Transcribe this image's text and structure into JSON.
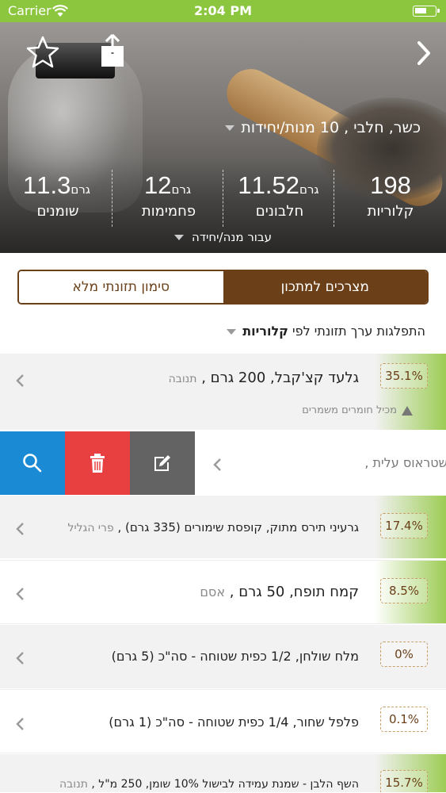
{
  "status_bar": {
    "carrier": "Carrier",
    "time": "2:04 PM"
  },
  "hero": {
    "kosher_info": "כשר, חלבי , 10 מנות/יחידות",
    "stats": [
      {
        "value": "198",
        "unit": "",
        "label": "קלוריות"
      },
      {
        "value": "11.52",
        "unit": "גרם",
        "label": "חלבונים"
      },
      {
        "value": "12",
        "unit": "גרם",
        "label": "פחמימות"
      },
      {
        "value": "11.3",
        "unit": "גרם",
        "label": "שומנים"
      }
    ],
    "serving_note": "עבור מנה/יחידה"
  },
  "tabs": {
    "active": "מצרכים למתכון",
    "inactive": "סימון תזונתי מלא"
  },
  "distribution": {
    "prefix": "התפלגות ערך תזונתי לפי",
    "metric": "קלוריות"
  },
  "ingredients": [
    {
      "percent": "35.1%",
      "name": "גלעד קצ'קבל, 200 גרם",
      "brand": "תנובה",
      "warning": "מכיל חומרים משמרים"
    },
    {
      "name": "שטראוס עלית"
    },
    {
      "percent": "17.4%",
      "name": "גרעיני תירס מתוק, קופסת שימורים (335 גרם)",
      "brand": "פרי הגליל"
    },
    {
      "percent": "8.5%",
      "name": "קמח תופח, 50 גרם",
      "brand": "אסם"
    },
    {
      "percent": "0%",
      "name": "מלח שולחן, 1/2 כפית שטוחה - סה\"כ (5 גרם)"
    },
    {
      "percent": "0.1%",
      "name": "פלפל שחור, 1/4 כפית שטוחה - סה\"כ (1 גרם)"
    },
    {
      "percent": "15.7%",
      "name": "השף הלבן - שמנת עמידה לבישול 10% שומן, 250 מ\"ל",
      "brand": "תנובה"
    }
  ],
  "icons": {
    "star": "star-icon",
    "share": "share-icon",
    "back": "chevron-right-icon",
    "search": "search-icon",
    "delete": "trash-icon",
    "edit": "edit-icon"
  },
  "colors": {
    "status_bar": "#8cc63f",
    "brown": "#6b4019",
    "search": "#1a8ad4",
    "delete": "#e84040",
    "edit": "#636363"
  }
}
